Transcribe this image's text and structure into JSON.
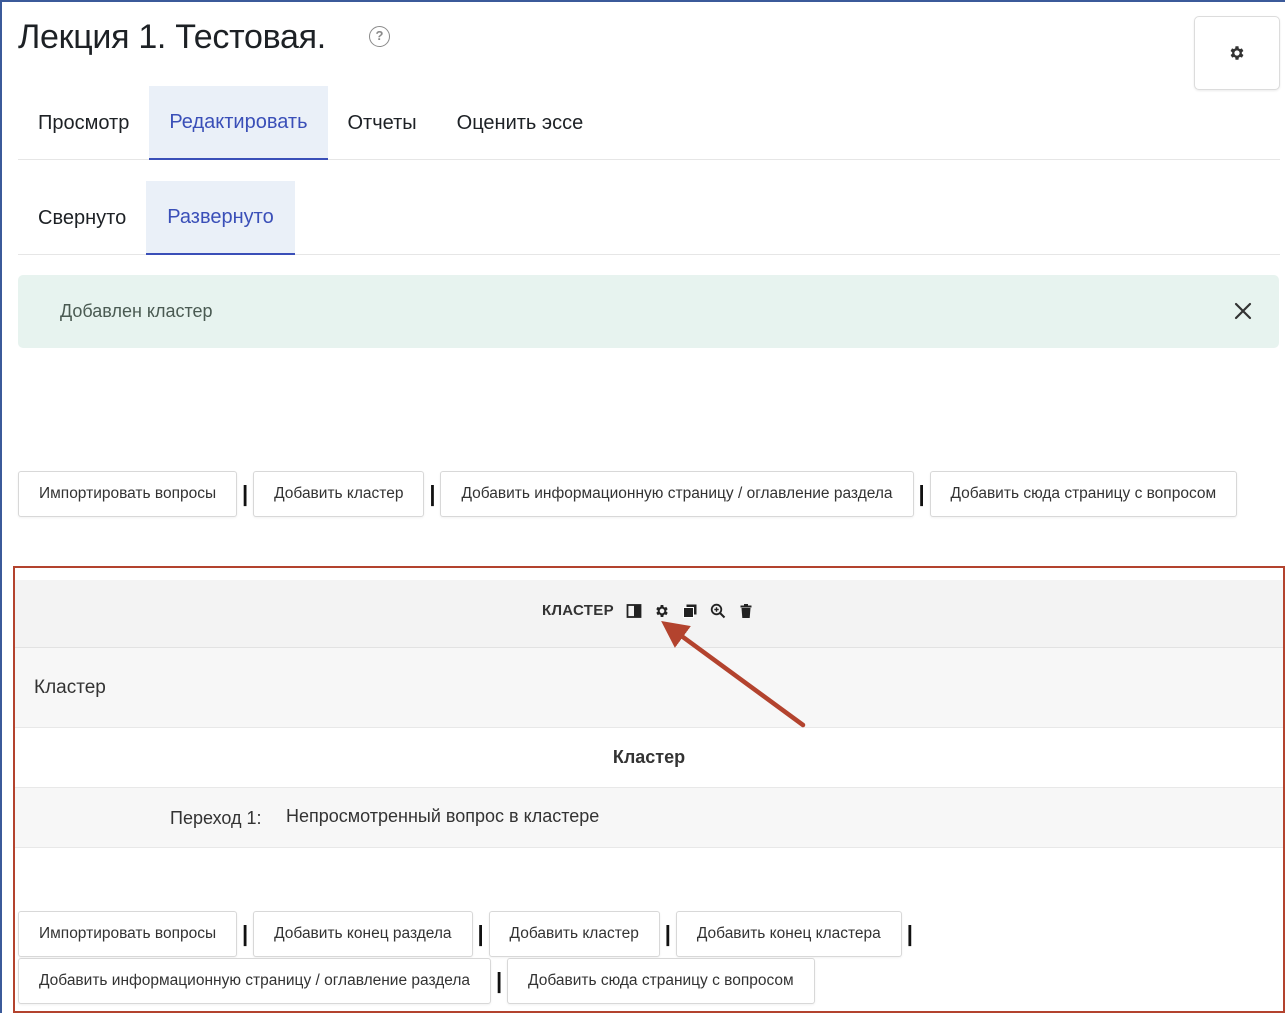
{
  "header": {
    "title": "Лекция 1. Тестовая.",
    "help_icon": "?"
  },
  "primary_tabs": [
    {
      "label": "Просмотр",
      "active": false
    },
    {
      "label": "Редактировать",
      "active": true
    },
    {
      "label": "Отчеты",
      "active": false
    },
    {
      "label": "Оценить эссе",
      "active": false
    }
  ],
  "secondary_tabs": [
    {
      "label": "Свернуто",
      "active": false
    },
    {
      "label": "Развернуто",
      "active": true
    }
  ],
  "alert": {
    "message": "Добавлен кластер"
  },
  "top_buttons": {
    "import": "Импортировать вопросы",
    "add_cluster": "Добавить кластер",
    "add_info_page": "Добавить информационную страницу / оглавление раздела",
    "add_question_page": "Добавить сюда страницу с вопросом"
  },
  "cluster": {
    "header_label": "КЛАСТЕР",
    "icons": [
      "layout-icon",
      "gear-icon",
      "copy-icon",
      "zoom-icon",
      "trash-icon"
    ],
    "name": "Кластер",
    "title": "Кластер",
    "jump_label": "Переход 1:",
    "jump_value": "Непросмотренный вопрос в кластере"
  },
  "bottom_buttons": {
    "import": "Импортировать вопросы",
    "add_section_end": "Добавить конец раздела",
    "add_cluster": "Добавить кластер",
    "add_cluster_end": "Добавить конец кластера",
    "add_info_page": "Добавить информационную страницу / оглавление раздела",
    "add_question_page": "Добавить сюда страницу с вопросом"
  },
  "colors": {
    "accent": "#3a4fb8",
    "active_tab_bg": "#eaf0f8",
    "alert_bg": "#e7f3ef",
    "highlight_border": "#b3432e",
    "arrow": "#b3432e"
  }
}
